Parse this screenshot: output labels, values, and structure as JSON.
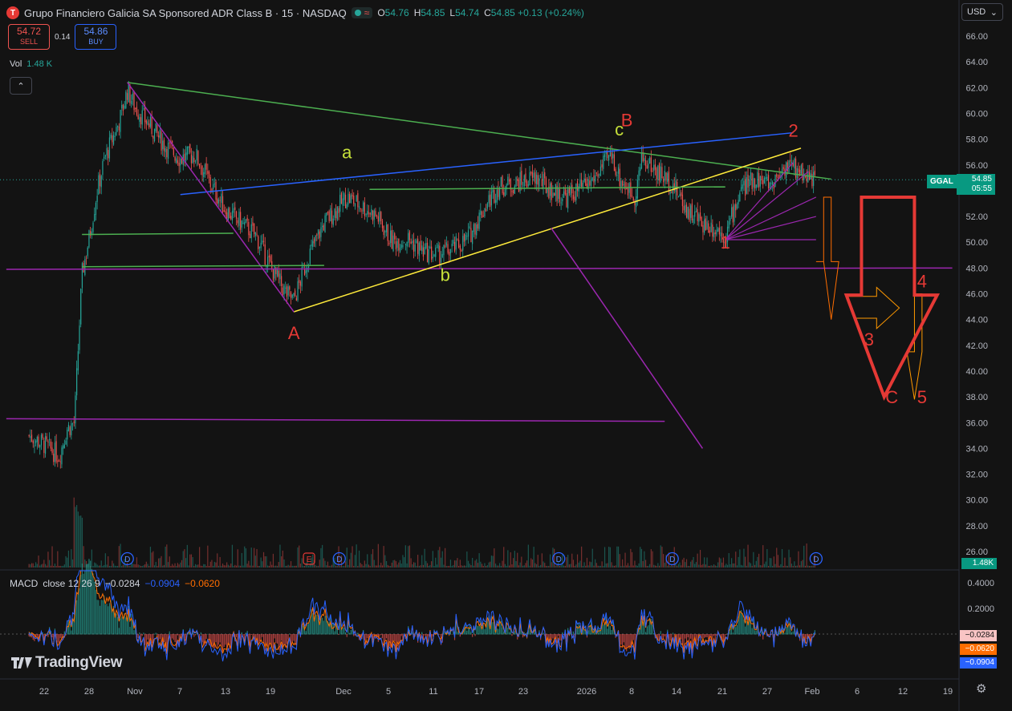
{
  "header": {
    "logo_letter": "T",
    "title": "Grupo Financiero Galicia SA Sponsored ADR Class B · 15 · NASDAQ",
    "wave_glyph": "≈",
    "ohlc": [
      {
        "k": "O",
        "v": "54.76"
      },
      {
        "k": "H",
        "v": "54.85"
      },
      {
        "k": "L",
        "v": "54.74"
      },
      {
        "k": "C",
        "v": "54.85 +0.13 (+0.24%)"
      }
    ]
  },
  "trade": {
    "sell_price": "54.72",
    "sell_label": "SELL",
    "spread": "0.14",
    "buy_price": "54.86",
    "buy_label": "BUY"
  },
  "volume": {
    "label": "Vol",
    "value": "1.48 K",
    "axis_label": "1.48K"
  },
  "collapse_glyph": "⌃",
  "currency": {
    "label": "USD",
    "chevron": "⌄"
  },
  "ticker": {
    "symbol": "GGAL",
    "price": "54.85",
    "countdown": "05:55"
  },
  "macd": {
    "name": "MACD",
    "params": "close 12 26 9",
    "hist": "−0.0284",
    "macd": "−0.0904",
    "signal": "−0.0620",
    "axis_labels": {
      "hist": "−0.0284",
      "signal": "−0.0620",
      "macd": "−0.0904"
    }
  },
  "branding": "TradingView",
  "settings_glyph": "⚙",
  "colors": {
    "bg": "#131313",
    "up": "#26a69a",
    "down": "#ef5350",
    "accent_blue": "#2962ff",
    "macd_signal": "#ff6d00"
  },
  "chart_data": {
    "type": "candlestick",
    "title": "Grupo Financiero Galicia SA Sponsored ADR Class B · 15 · NASDAQ",
    "price_axis": {
      "ticks": [
        "26.00",
        "28.00",
        "30.00",
        "32.00",
        "34.00",
        "36.00",
        "38.00",
        "40.00",
        "42.00",
        "44.00",
        "46.00",
        "48.00",
        "50.00",
        "52.00",
        "54.00",
        "56.00",
        "58.00",
        "60.00",
        "62.00",
        "64.00",
        "66.00"
      ],
      "ylim": [
        25,
        67
      ]
    },
    "macd_axis": {
      "ticks": [
        "0.4000",
        "0.2000",
        "0.0000"
      ]
    },
    "time_axis": {
      "ticks": [
        "22",
        "28",
        "Nov",
        "7",
        "13",
        "19",
        "Dec",
        "5",
        "11",
        "17",
        "23",
        "2026",
        "8",
        "14",
        "21",
        "27",
        "Feb",
        "6",
        "12",
        "19"
      ]
    },
    "price_path": [
      {
        "t": "Oct 20",
        "p": 35.0
      },
      {
        "t": "Oct 22",
        "p": 34.3
      },
      {
        "t": "Oct 24",
        "p": 33.4
      },
      {
        "t": "Oct 25",
        "p": 35.5
      },
      {
        "t": "Oct 26",
        "p": 36.0
      },
      {
        "t": "Oct 27",
        "p": 47.5
      },
      {
        "t": "Oct 28",
        "p": 50.5
      },
      {
        "t": "Oct 29",
        "p": 54.0
      },
      {
        "t": "Oct 30",
        "p": 56.5
      },
      {
        "t": "Nov 1",
        "p": 59.5
      },
      {
        "t": "Nov 2",
        "p": 61.8
      },
      {
        "t": "Nov 3",
        "p": 60.5
      },
      {
        "t": "Nov 5",
        "p": 59.0
      },
      {
        "t": "Nov 7",
        "p": 57.5
      },
      {
        "t": "Nov 9",
        "p": 56.5
      },
      {
        "t": "Nov 11",
        "p": 56.8
      },
      {
        "t": "Nov 13",
        "p": 54.5
      },
      {
        "t": "Nov 15",
        "p": 52.5
      },
      {
        "t": "Nov 17",
        "p": 51.5
      },
      {
        "t": "Nov 19",
        "p": 50.5
      },
      {
        "t": "Nov 21",
        "p": 48.0
      },
      {
        "t": "Nov 23",
        "p": 46.0
      },
      {
        "t": "Nov 24",
        "p": 45.5
      },
      {
        "t": "Nov 26",
        "p": 49.0
      },
      {
        "t": "Nov 28",
        "p": 51.5
      },
      {
        "t": "Dec 1",
        "p": 53.5
      },
      {
        "t": "Dec 3",
        "p": 52.8
      },
      {
        "t": "Dec 5",
        "p": 52.0
      },
      {
        "t": "Dec 7",
        "p": 50.0
      },
      {
        "t": "Dec 9",
        "p": 50.3
      },
      {
        "t": "Dec 11",
        "p": 49.3
      },
      {
        "t": "Dec 13",
        "p": 49.0
      },
      {
        "t": "Dec 15",
        "p": 49.5
      },
      {
        "t": "Dec 17",
        "p": 50.3
      },
      {
        "t": "Dec 19",
        "p": 52.5
      },
      {
        "t": "Dec 21",
        "p": 54.3
      },
      {
        "t": "Dec 23",
        "p": 54.5
      },
      {
        "t": "Dec 26",
        "p": 55.0
      },
      {
        "t": "Dec 28",
        "p": 54.0
      },
      {
        "t": "Dec 30",
        "p": 53.5
      },
      {
        "t": "Jan 2",
        "p": 54.5
      },
      {
        "t": "Jan 5",
        "p": 56.8
      },
      {
        "t": "Jan 6",
        "p": 55.0
      },
      {
        "t": "Jan 8",
        "p": 53.5
      },
      {
        "t": "Jan 9",
        "p": 56.5
      },
      {
        "t": "Jan 11",
        "p": 55.5
      },
      {
        "t": "Jan 13",
        "p": 54.5
      },
      {
        "t": "Jan 15",
        "p": 52.5
      },
      {
        "t": "Jan 17",
        "p": 51.5
      },
      {
        "t": "Jan 19",
        "p": 51.0
      },
      {
        "t": "Jan 20",
        "p": 50.5
      },
      {
        "t": "Jan 22",
        "p": 54.0
      },
      {
        "t": "Jan 24",
        "p": 55.0
      },
      {
        "t": "Jan 26",
        "p": 54.5
      },
      {
        "t": "Jan 28",
        "p": 56.0
      },
      {
        "t": "Jan 30",
        "p": 55.5
      },
      {
        "t": "Feb 1",
        "p": 54.85
      }
    ],
    "event_markers": [
      {
        "t": "Nov 2",
        "label": "D"
      },
      {
        "t": "Nov 26",
        "label": "E"
      },
      {
        "t": "Nov 30",
        "label": "D"
      },
      {
        "t": "Dec 29",
        "label": "D"
      },
      {
        "t": "Jan 13",
        "label": "D"
      },
      {
        "t": "Feb 1",
        "label": "D"
      }
    ],
    "wave_labels": [
      {
        "text": "A",
        "t": "Nov 24",
        "p": 42.5,
        "color": "#e53935"
      },
      {
        "text": "a",
        "t": "Dec 1",
        "p": 56.5,
        "color": "#c6e03a"
      },
      {
        "text": "b",
        "t": "Dec 14",
        "p": 47.0,
        "color": "#c6e03a"
      },
      {
        "text": "c",
        "t": "Jan 6",
        "p": 58.3,
        "color": "#c6e03a"
      },
      {
        "text": "B",
        "t": "Jan 7",
        "p": 59.0,
        "color": "#e53935"
      },
      {
        "text": "1",
        "t": "Jan 20",
        "p": 49.5,
        "color": "#e53935"
      },
      {
        "text": "2",
        "t": "Jan 29",
        "p": 58.2,
        "color": "#e53935"
      },
      {
        "text": "3",
        "t": "Feb 8",
        "p": 42.0,
        "color": "#e53935"
      },
      {
        "text": "4",
        "t": "Feb 15",
        "p": 46.5,
        "color": "#e53935"
      },
      {
        "text": "C",
        "t": "Feb 11",
        "p": 37.5,
        "color": "#e53935"
      },
      {
        "text": "5",
        "t": "Feb 15",
        "p": 37.5,
        "color": "#e53935"
      }
    ],
    "grid": false
  }
}
